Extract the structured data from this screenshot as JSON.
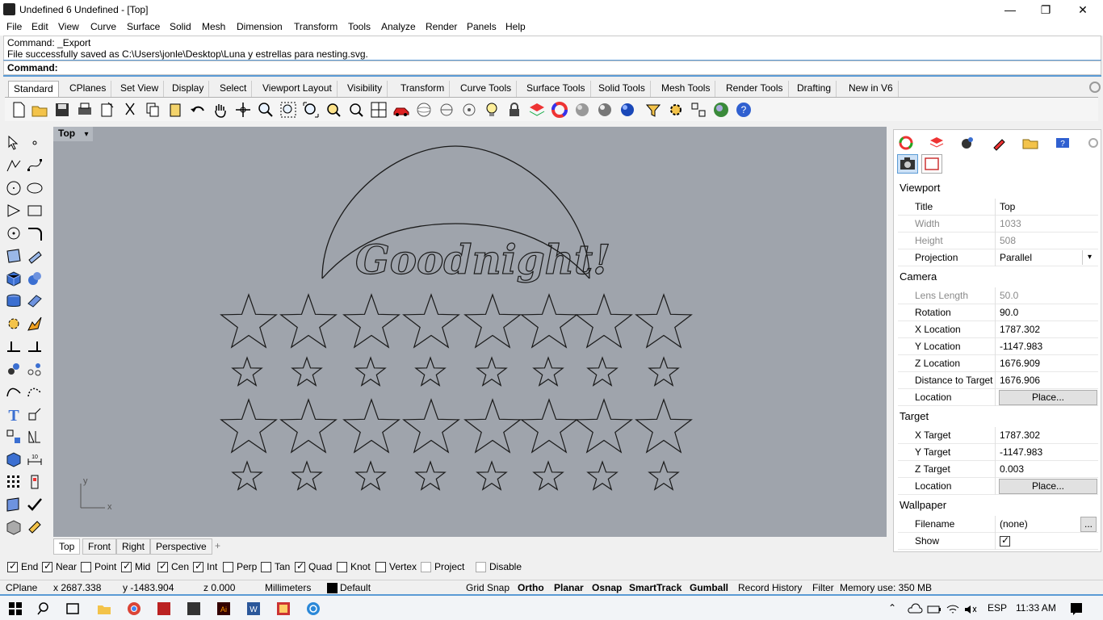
{
  "window": {
    "title": "Undefined 6 Undefined - [Top]",
    "minimize": "—",
    "restore": "❐",
    "close": "✕"
  },
  "menu": [
    "File",
    "Edit",
    "View",
    "Curve",
    "Surface",
    "Solid",
    "Mesh",
    "Dimension",
    "Transform",
    "Tools",
    "Analyze",
    "Render",
    "Panels",
    "Help"
  ],
  "command_history": [
    "Command: _Export",
    "File successfully saved as C:\\Users\\jonle\\Desktop\\Luna y estrellas para nesting.svg."
  ],
  "command_prompt": "Command:",
  "toolbar_tabs": [
    "Standard",
    "CPlanes",
    "Set View",
    "Display",
    "Select",
    "Viewport Layout",
    "Visibility",
    "Transform",
    "Curve Tools",
    "Surface Tools",
    "Solid Tools",
    "Mesh Tools",
    "Render Tools",
    "Drafting",
    "New in V6"
  ],
  "toolbar_icons": [
    "new-file-icon",
    "open-icon",
    "save-icon",
    "print-icon",
    "import-icon",
    "cut-icon",
    "copy-icon",
    "paste-icon",
    "undo-icon",
    "pan-icon",
    "rotate-view-icon",
    "zoom-icon",
    "zoom-window-icon",
    "zoom-extents-icon",
    "zoom-selected-icon",
    "rotate-icon",
    "four-viewports-icon",
    "car-icon",
    "circle-target-icon",
    "bulb-icon",
    "lock-icon",
    "layer-icon",
    "color-wheel-icon",
    "sphere-shaded-icon",
    "sphere-render-icon",
    "blue-sphere-icon",
    "sun-icon",
    "gear-icon",
    "settings-icon",
    "globe-icon",
    "help-icon"
  ],
  "viewport": {
    "title": "Top",
    "dropdown_glyph": "▾",
    "heading_text": "Goodnight!",
    "axis_x": "x",
    "axis_y": "y",
    "tabs": [
      "Top",
      "Front",
      "Right",
      "Perspective"
    ],
    "add_tab": "+"
  },
  "panel": {
    "tabs": [
      "color-wheel-icon",
      "layers-icon",
      "render-icon",
      "brush-icon",
      "folder-icon",
      "help-icon"
    ],
    "subtabs": [
      "camera-icon",
      "viewport-icon"
    ],
    "viewport_section": "Viewport",
    "viewport_rows": [
      {
        "label": "Title",
        "value": "Top",
        "dim": false
      },
      {
        "label": "Width",
        "value": "1033",
        "dim": true
      },
      {
        "label": "Height",
        "value": "508",
        "dim": true
      },
      {
        "label": "Projection",
        "value": "Parallel",
        "dim": false,
        "dropdown": true
      }
    ],
    "camera_section": "Camera",
    "camera_rows": [
      {
        "label": "Lens Length",
        "value": "50.0",
        "dim": true
      },
      {
        "label": "Rotation",
        "value": "90.0",
        "dim": false
      },
      {
        "label": "X Location",
        "value": "1787.302",
        "dim": false
      },
      {
        "label": "Y Location",
        "value": "-1147.983",
        "dim": false
      },
      {
        "label": "Z Location",
        "value": "1676.909",
        "dim": false
      },
      {
        "label": "Distance to Target",
        "value": "1676.906",
        "dim": false
      },
      {
        "label": "Location",
        "button": "Place..."
      }
    ],
    "target_section": "Target",
    "target_rows": [
      {
        "label": "X Target",
        "value": "1787.302"
      },
      {
        "label": "Y Target",
        "value": "-1147.983"
      },
      {
        "label": "Z Target",
        "value": "0.003"
      },
      {
        "label": "Location",
        "button": "Place..."
      }
    ],
    "wallpaper_section": "Wallpaper",
    "wallpaper_rows": [
      {
        "label": "Filename",
        "value": "(none)",
        "button": "..."
      },
      {
        "label": "Show",
        "checked": true
      }
    ]
  },
  "osnaps": [
    {
      "label": "End",
      "checked": true
    },
    {
      "label": "Near",
      "checked": true
    },
    {
      "label": "Point",
      "checked": false
    },
    {
      "label": "Mid",
      "checked": true
    },
    {
      "label": "Cen",
      "checked": true
    },
    {
      "label": "Int",
      "checked": true
    },
    {
      "label": "Perp",
      "checked": false
    },
    {
      "label": "Tan",
      "checked": false
    },
    {
      "label": "Quad",
      "checked": true
    },
    {
      "label": "Knot",
      "checked": false
    },
    {
      "label": "Vertex",
      "checked": false
    },
    {
      "label": "Project",
      "checked": false
    },
    {
      "label": "Disable",
      "checked": false
    }
  ],
  "status": {
    "cplane": "CPlane",
    "x": "x 2687.338",
    "y": "y -1483.904",
    "z": "z 0.000",
    "units": "Millimeters",
    "layer": "Default",
    "grid_snap": "Grid Snap",
    "ortho": "Ortho",
    "planar": "Planar",
    "osnap": "Osnap",
    "smarttrack": "SmartTrack",
    "gumball": "Gumball",
    "record_history": "Record History",
    "filter": "Filter",
    "memory": "Memory use: 350 MB"
  },
  "taskbar": {
    "icons": [
      "windows-start-icon",
      "search-icon",
      "task-view-icon",
      "file-explorer-icon",
      "chrome-icon",
      "app-2015-icon",
      "rhino-icon",
      "illustrator-icon",
      "word-icon",
      "calculator-icon",
      "cortana-icon"
    ],
    "tray_language": "ESP",
    "clock": "11:33 AM"
  },
  "colors": {
    "viewport_bg": "#9fa4ac",
    "accent_blue": "#5b9bd5"
  }
}
